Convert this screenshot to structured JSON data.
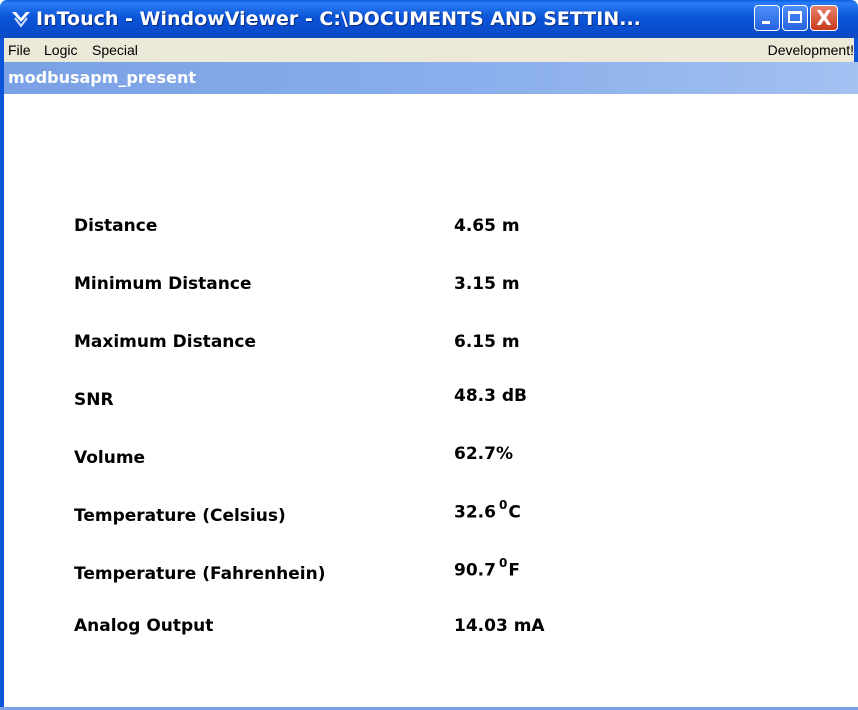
{
  "window": {
    "title": "InTouch - WindowViewer - C:\\DOCUMENTS AND SETTIN...",
    "icon": "intouch-app-icon",
    "controls": {
      "minimize": "minimize",
      "maximize": "maximize",
      "close": "X"
    }
  },
  "menubar": {
    "items": [
      "File",
      "Logic",
      "Special"
    ],
    "development": "Development!"
  },
  "inner_window": {
    "title": "modbusapm_present"
  },
  "readings": [
    {
      "label": "Distance",
      "value": "4.65 m"
    },
    {
      "label": "Minimum Distance",
      "value": "3.15 m"
    },
    {
      "label": "Maximum Distance",
      "value": "6.15 m"
    },
    {
      "label": "SNR",
      "value": "48.3 dB"
    },
    {
      "label": "Volume",
      "value": "62.7%"
    },
    {
      "label": "Temperature (Celsius)",
      "value": "32.6",
      "sup": "0",
      "unit": "C"
    },
    {
      "label": "Temperature (Fahrenhein)",
      "value": "90.7",
      "sup": "0",
      "unit": "F"
    },
    {
      "label": "Analog Output",
      "value": "14.03 mA"
    }
  ],
  "colors": {
    "titlebar": "#0b55d8",
    "inner_caption": "#8cb0ec",
    "menubar": "#ece9d8",
    "close_button": "#c93a1c"
  }
}
